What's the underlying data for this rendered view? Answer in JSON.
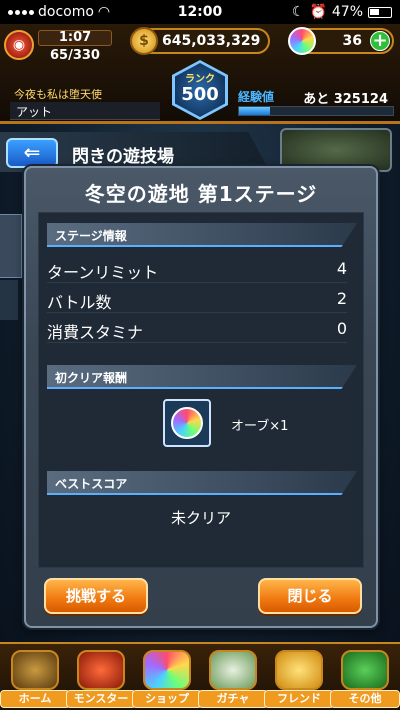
{
  "status_bar": {
    "carrier": "docomo",
    "time": "12:00",
    "battery": "47%"
  },
  "hud": {
    "stamina_timer": "1:07",
    "stamina": "65/330",
    "coins": "645,033,329",
    "orbs": "36",
    "rank_label": "ランク",
    "rank": "500",
    "player_motto": "今夜も私は堕天使",
    "player_name": "アット",
    "exp_label": "経験値",
    "exp_remaining": "あと 325124",
    "exp_progress": 0.2
  },
  "background": {
    "back_label": "⇐",
    "area_title": "閃きの遊技場"
  },
  "modal": {
    "title": "冬空の遊地 第1ステージ",
    "stage_info_header": "ステージ情報",
    "rows": [
      {
        "label": "ターンリミット",
        "value": "4"
      },
      {
        "label": "バトル数",
        "value": "2"
      },
      {
        "label": "消費スタミナ",
        "value": "0"
      }
    ],
    "first_clear_header": "初クリア報酬",
    "reward_text": "オーブ×1",
    "best_score_header": "ベストスコア",
    "best_score": "未クリア",
    "challenge_button": "挑戦する",
    "close_button": "閉じる"
  },
  "nav": [
    {
      "label": "ホーム",
      "icon": "home-icon"
    },
    {
      "label": "モンスター",
      "icon": "monster-icon"
    },
    {
      "label": "ショップ",
      "icon": "shop-icon"
    },
    {
      "label": "ガチャ",
      "icon": "gacha-icon"
    },
    {
      "label": "フレンド",
      "icon": "friend-icon"
    },
    {
      "label": "その他",
      "icon": "other-icon"
    }
  ]
}
